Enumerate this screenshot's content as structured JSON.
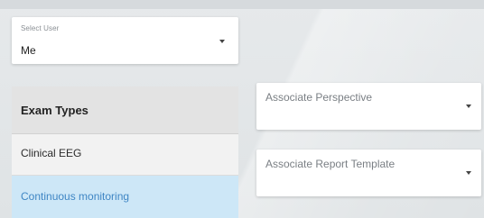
{
  "user_select": {
    "label": "Select User",
    "value": "Me"
  },
  "exam_types": {
    "header": "Exam Types",
    "items": [
      {
        "label": "Clinical EEG",
        "selected": false
      },
      {
        "label": "Continuous monitoring",
        "selected": true
      }
    ]
  },
  "perspective_select": {
    "placeholder": "Associate Perspective"
  },
  "report_select": {
    "placeholder": "Associate Report Template"
  },
  "colors": {
    "background": "#e4e8ea",
    "card": "#ffffff",
    "selected_bg": "#cde7f7",
    "selected_text": "#3f86c4",
    "header_bg": "#e3e3e3"
  },
  "icons": {
    "dropdown": "caret-down-icon"
  }
}
